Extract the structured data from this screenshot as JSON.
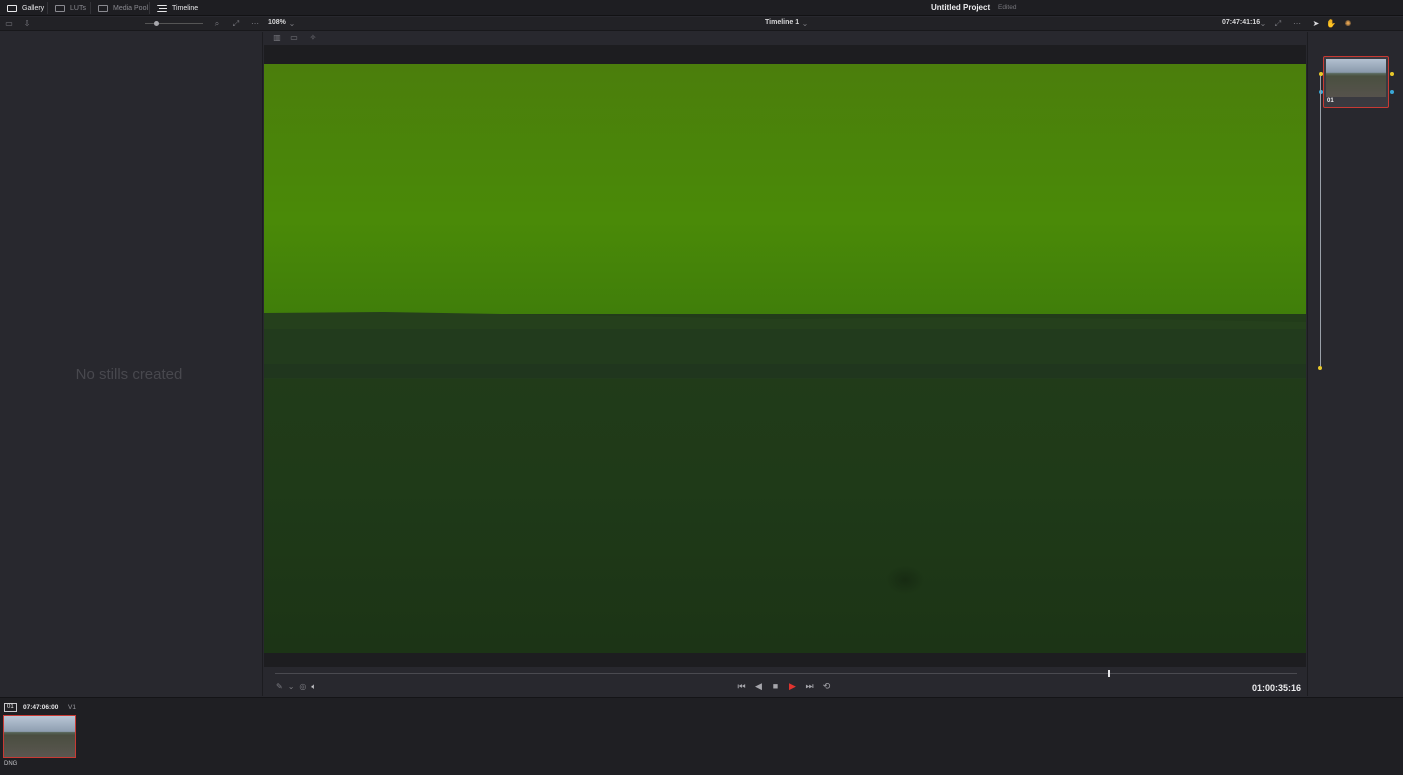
{
  "topbar": {
    "tabs": [
      {
        "label": "Gallery",
        "active": true
      },
      {
        "label": "LUTs",
        "active": false
      },
      {
        "label": "Media Pool",
        "active": false
      },
      {
        "label": "Timeline",
        "active": true
      }
    ],
    "project_title": "Untitled Project",
    "project_status": "Edited"
  },
  "toolbar": {
    "zoom": "108%",
    "timeline_name": "Timeline 1",
    "timecode": "07:47:41:16"
  },
  "gallery": {
    "empty_message": "No stills created"
  },
  "viewer": {
    "playhead_position": 0.815,
    "timecode": "01:00:35:16",
    "colors": {
      "sky": "#4a7d0e",
      "treeline": "#25401c",
      "ground": "#1d3418"
    }
  },
  "nodes": {
    "node_label": "01"
  },
  "clips": {
    "clip_number": "01",
    "clip_timecode": "07:47:06:00",
    "track": "V1",
    "codec": "DNG"
  },
  "accents": {
    "selection_red": "#c83a34",
    "play_red": "#e2342f"
  }
}
